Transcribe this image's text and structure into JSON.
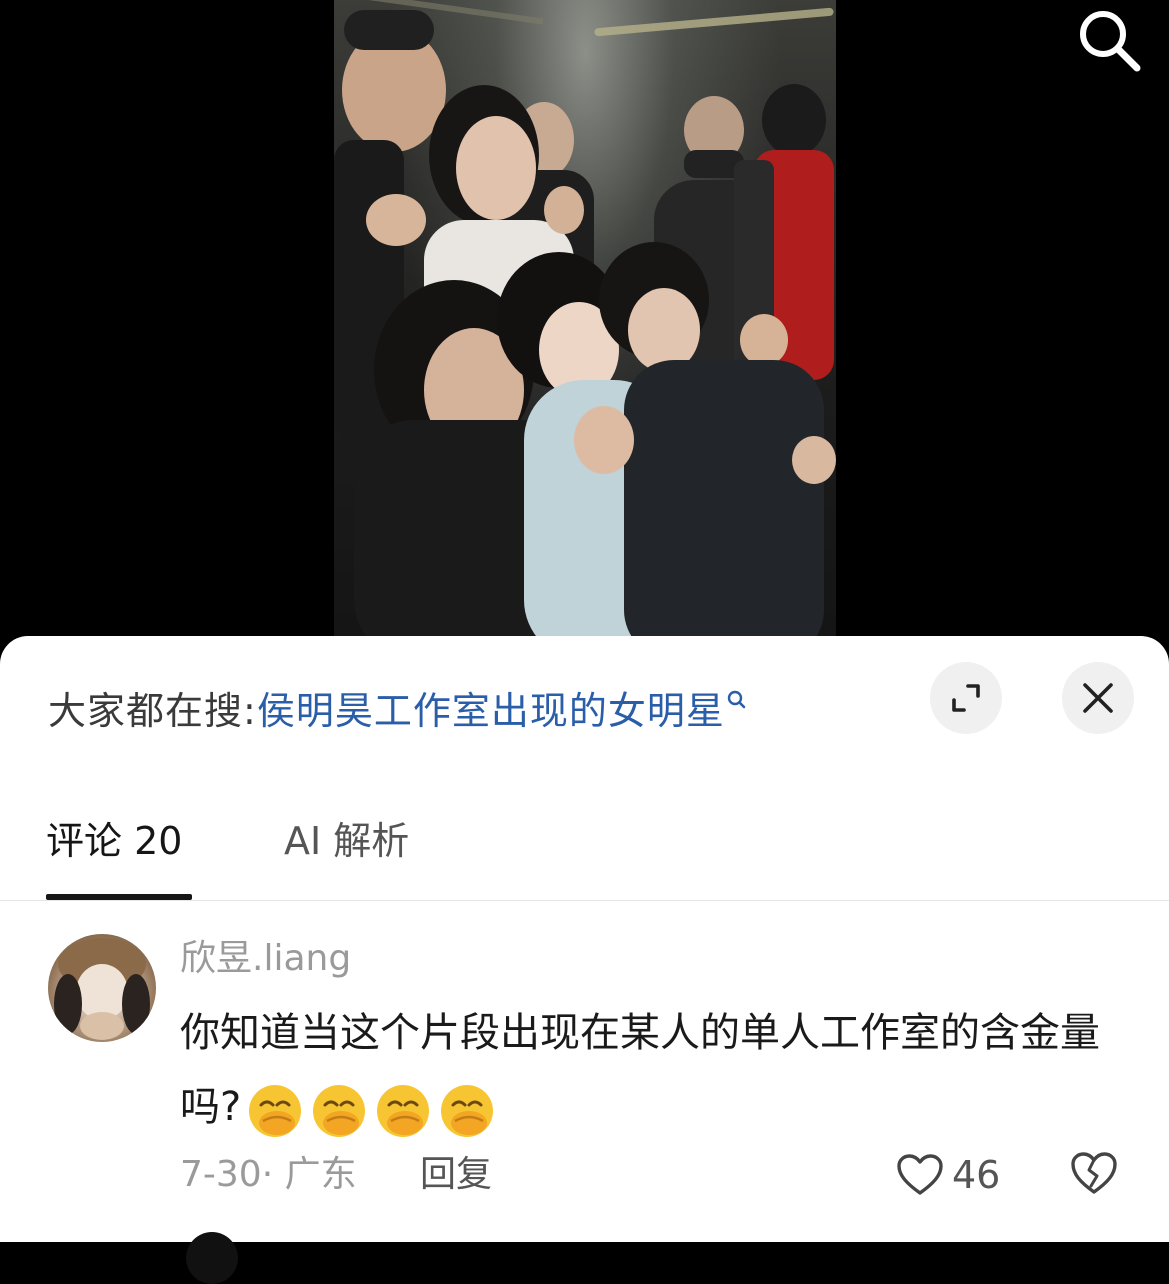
{
  "video": {
    "search_icon": "search-icon"
  },
  "sheet": {
    "suggestion": {
      "prefix": "大家都在搜:",
      "query": "侯明昊工作室出现的女明星",
      "query_icon": "search-icon"
    },
    "buttons": {
      "expand_icon": "expand-icon",
      "close_icon": "close-icon"
    },
    "tabs": [
      {
        "label": "评论 20",
        "active": true
      },
      {
        "label": "AI 解析",
        "active": false
      }
    ],
    "comment": {
      "username": "欣昱.liang",
      "text": "你知道当这个片段出现在某人的单人工作室的含金量吗?",
      "emoji": [
        "hand-over-mouth-emoji",
        "hand-over-mouth-emoji",
        "hand-over-mouth-emoji",
        "hand-over-mouth-emoji"
      ],
      "meta": "7-30· 广东",
      "reply_label": "回复",
      "like_count": "46",
      "like_icon": "heart-icon",
      "dislike_icon": "broken-heart-icon"
    }
  },
  "colors": {
    "link": "#2a5ea8",
    "muted": "#9a9a9a",
    "text": "#1a1a1a"
  }
}
